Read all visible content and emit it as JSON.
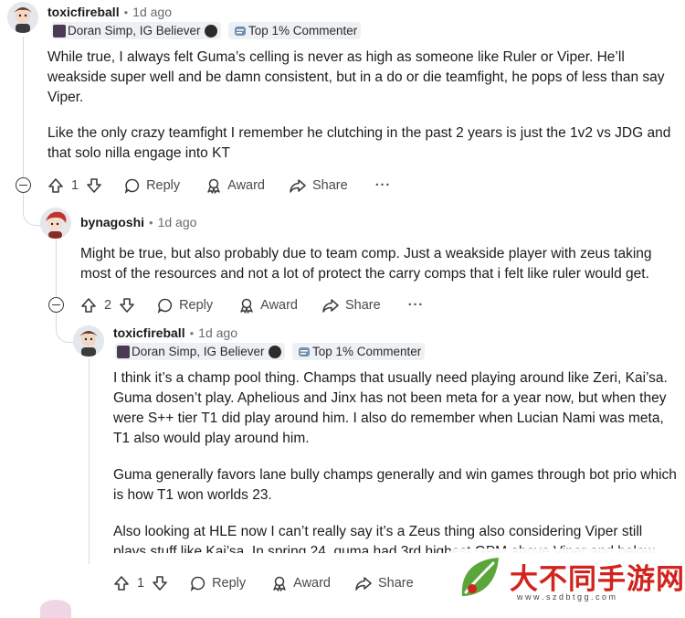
{
  "comments": [
    {
      "username": "toxicfireball",
      "time": "1d ago",
      "flair_user": "Doran Simp, IG Believer",
      "flair_badge": "Top 1% Commenter",
      "paragraphs": [
        "While true, I always felt Guma’s celling is never as high as someone like Ruler or Viper. He’ll weakside super well and be damn consistent, but in a do or die teamfight, he pops of less than say Viper.",
        "Like the only crazy teamfight I remember he clutching in the past 2 years is just the 1v2 vs JDG and that solo nilla engage into KT"
      ],
      "votes": "1"
    },
    {
      "username": "bynagoshi",
      "time": "1d ago",
      "paragraphs": [
        "Might be true, but also probably due to team comp. Just a weakside player with zeus taking most of the resources and not a lot of protect the carry comps that i felt like ruler would get."
      ],
      "votes": "2"
    },
    {
      "username": "toxicfireball",
      "time": "1d ago",
      "flair_user": "Doran Simp, IG Believer",
      "flair_badge": "Top 1% Commenter",
      "paragraphs": [
        "I think it’s a champ pool thing. Champs that usually need playing around like Zeri, Kai’sa. Guma dosen’t play. Aphelious and Jinx has not been meta for a year now, but when they were S++ tier T1 did play around him. I also do remember when Lucian Nami was meta, T1 also would play around him.",
        "Guma generally favors lane bully champs generally and win games through bot prio which is how T1 won worlds 23.",
        "Also looking at HLE now I can’t really say it’s a Zeus thing also considering Viper still plays stuff like Kai’sa. In spring 24, guma had 3rd highest GPM above Viper and below Aiming"
      ],
      "votes": "1"
    }
  ],
  "actions": {
    "reply": "Reply",
    "award": "Award",
    "share": "Share",
    "more": "···"
  },
  "watermark": {
    "title": "大不同手游网",
    "url": "w w w . s z d b t g g . c o m"
  },
  "colors": {
    "flair_bg": "#eef1f4",
    "thread_line": "#d6dadd",
    "watermark_green": "#5aa63a",
    "watermark_red": "#d2231e"
  }
}
